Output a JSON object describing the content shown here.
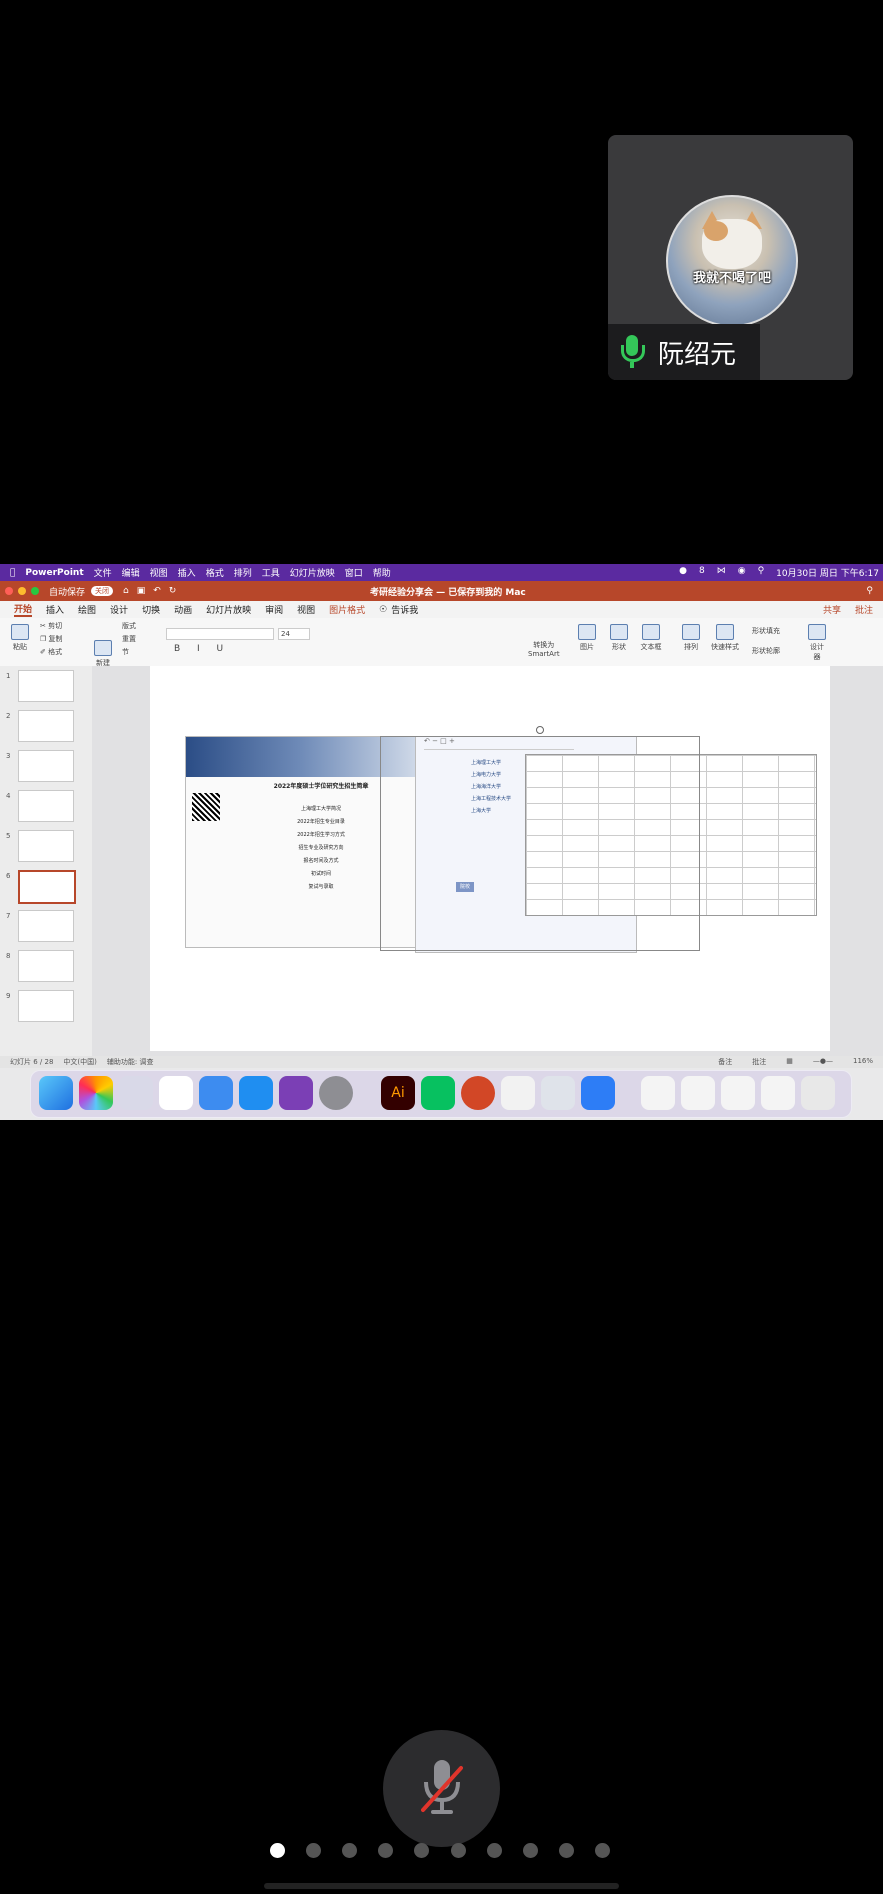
{
  "participant": {
    "name": "阮绍元",
    "avatar_caption": "我就不喝了吧",
    "mic_status": "on"
  },
  "mac_menubar": {
    "app": "PowerPoint",
    "items": [
      "文件",
      "编辑",
      "视图",
      "插入",
      "格式",
      "排列",
      "工具",
      "幻灯片放映",
      "窗口",
      "帮助"
    ],
    "battery": "8",
    "clock": "10月30日 周日 下午6:17"
  },
  "window": {
    "autosave_label": "自动保存",
    "autosave_state": "关闭",
    "doc_title": "考研经验分享会 — 已保存到我的 Mac"
  },
  "ribbon": {
    "tabs": [
      "开始",
      "插入",
      "绘图",
      "设计",
      "切换",
      "动画",
      "幻灯片放映",
      "审阅",
      "视图",
      "图片格式"
    ],
    "tell_me": "告诉我",
    "share": "共享",
    "comment": "批注"
  },
  "toolbar": {
    "paste": "粘贴",
    "cut": "剪切",
    "copy": "复制",
    "format": "格式",
    "new_slide": "新建\n幻灯片",
    "layout": "版式",
    "reset": "重置",
    "section": "节",
    "font_size": "24",
    "convert_smartart": "转换为\nSmartArt",
    "picture": "图片",
    "shapes": "形状",
    "textbox": "文本框",
    "arrange": "排列",
    "quick_styles": "快速样式",
    "shape_fill": "形状填充",
    "shape_outline": "形状轮廓",
    "designer": "设计\n器"
  },
  "slides": {
    "numbers": [
      "1",
      "2",
      "3",
      "4",
      "5",
      "6",
      "7",
      "8",
      "9"
    ],
    "selected": 6
  },
  "slide_content": {
    "web_heading": "2022年度硕士学位研究生招生简章",
    "web_lines": [
      "上海理工大学简况",
      "2022年招生专业目录",
      "2022年招生学习方式",
      "招生专业及研究方向",
      "报名时间及方式",
      "初试时间",
      "复试与录取"
    ],
    "mind_nodes": [
      "上海理工大学",
      "上海电力大学",
      "上海海洋大学",
      "上海工程技术大学",
      "上海大学"
    ],
    "mind_center": "院校"
  },
  "statusbar": {
    "slide_pos": "幻灯片 6 / 28",
    "language": "中文(中国)",
    "accessibility": "辅助功能: 调查",
    "notes": "备注",
    "comments": "批注",
    "zoom": "116%"
  }
}
